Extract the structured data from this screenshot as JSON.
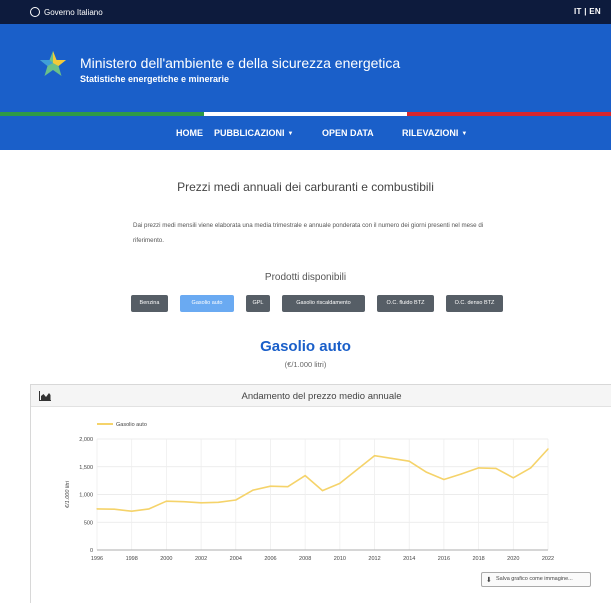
{
  "topbar": {
    "gov_label": "Governo Italiano",
    "lang_it": "IT",
    "lang_sep": "|",
    "lang_en": "EN"
  },
  "header": {
    "title": "Ministero dell'ambiente e della sicurezza energetica",
    "subtitle": "Statistiche energetiche e minerarie"
  },
  "colors": {
    "header_blue": "#1a5fc9",
    "topbar_navy": "#0d1b3d",
    "stripe_green": "#2e9a47",
    "stripe_white": "#ffffff",
    "stripe_red": "#d6262e",
    "line_yellow": "#f5d36a",
    "active_button": "#6aaaf2",
    "button_grey": "#565e66"
  },
  "nav": {
    "items": [
      {
        "label": "HOME",
        "caret": ""
      },
      {
        "label": "PUBBLICAZIONI",
        "caret": "▼"
      },
      {
        "label": "OPEN DATA",
        "caret": ""
      },
      {
        "label": "RILEVAZIONI",
        "caret": "▼"
      }
    ]
  },
  "main": {
    "title": "Prezzi medi annuali dei carburanti e combustibili",
    "description": "Dai prezzi medi mensili viene elaborata una media trimestrale e annuale ponderata con il numero dei giorni presenti nel mese di riferimento.",
    "products_title": "Prodotti disponibili",
    "products": [
      {
        "label": "Benzina",
        "active": false
      },
      {
        "label": "Gasolio auto",
        "active": true
      },
      {
        "label": "GPL",
        "active": false
      },
      {
        "label": "Gasolio riscaldamento",
        "active": false
      },
      {
        "label": "O.C. fluido BTZ",
        "active": false
      },
      {
        "label": "O.C. denso BTZ",
        "active": false
      }
    ],
    "selected_product": "Gasolio auto",
    "unit": "(€/1.000 litri)"
  },
  "card": {
    "title": "Andamento del prezzo medio annuale",
    "icon": "area-chart-icon",
    "save_label": "Salva grafico come immagine..."
  },
  "chart_data": {
    "type": "line",
    "title": "",
    "xlabel": "",
    "ylabel": "€/1.000 litri",
    "legend_position": "top-left",
    "grid": true,
    "ylim": [
      0,
      2000
    ],
    "xlim": [
      1996,
      2022
    ],
    "y_ticks": [
      0,
      500,
      1000,
      1500,
      2000
    ],
    "y_tick_labels": [
      "0",
      "500",
      "1,000",
      "1,500",
      "2,000"
    ],
    "x_ticks": [
      1996,
      1998,
      2000,
      2002,
      2004,
      2006,
      2008,
      2010,
      2012,
      2014,
      2016,
      2018,
      2020,
      2022
    ],
    "x_tick_labels": [
      "1996",
      "1998",
      "2000",
      "2002",
      "2004",
      "2006",
      "2008",
      "2010",
      "2012",
      "2014",
      "2016",
      "2018",
      "2020",
      "2022"
    ],
    "series": [
      {
        "name": "Gasolio auto",
        "color": "#f5d36a",
        "x": [
          1996,
          1997,
          1998,
          1999,
          2000,
          2001,
          2002,
          2003,
          2004,
          2005,
          2006,
          2007,
          2008,
          2009,
          2010,
          2011,
          2012,
          2013,
          2014,
          2015,
          2016,
          2017,
          2018,
          2019,
          2020,
          2021,
          2022
        ],
        "values": [
          740,
          735,
          700,
          740,
          880,
          870,
          850,
          860,
          900,
          1080,
          1150,
          1140,
          1340,
          1070,
          1200,
          1450,
          1700,
          1650,
          1600,
          1400,
          1270,
          1370,
          1480,
          1470,
          1300,
          1480,
          1820
        ]
      }
    ]
  }
}
